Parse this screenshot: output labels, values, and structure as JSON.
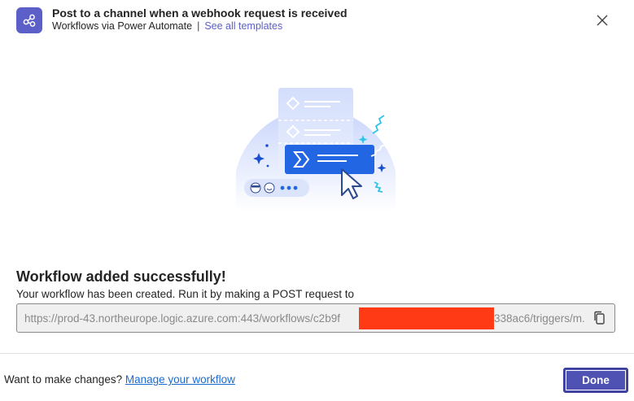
{
  "header": {
    "title": "Post to a channel when a webhook request is received",
    "subtitle": "Workflows via Power Automate",
    "separator": "|",
    "templates_link": "See all templates",
    "app_icon": "connector-icon",
    "close_icon": "close-icon"
  },
  "main": {
    "success_title": "Workflow added successfully!",
    "success_description": "Your workflow has been created. Run it by making a POST request to",
    "url_value": "https://prod-43.northeurope.logic.azure.com:443/workflows/c2b9f",
    "url_suffix": "338ac6/triggers/m...",
    "copy_icon": "copy-icon"
  },
  "footer": {
    "prompt": "Want to make changes?",
    "manage_link": "Manage your workflow",
    "done_label": "Done"
  },
  "colors": {
    "brand": "#5b5fc7",
    "done_button": "#4f52b2",
    "link": "#1a6bd1",
    "redaction": "#ff3a14"
  }
}
